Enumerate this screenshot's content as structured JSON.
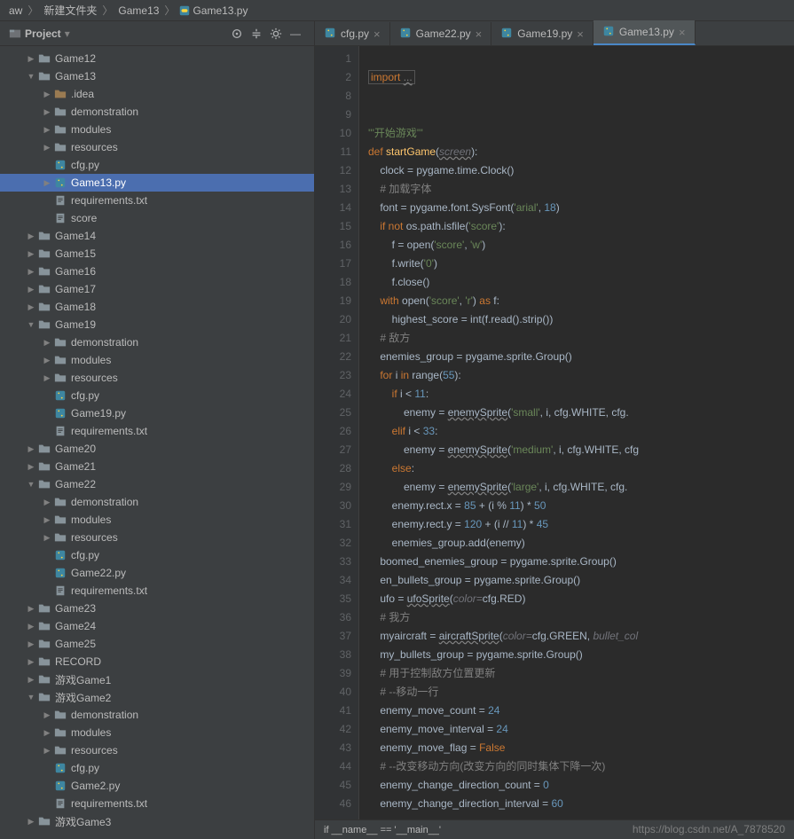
{
  "breadcrumb": [
    "aw",
    "新建文件夹",
    "Game13",
    "Game13.py"
  ],
  "sidebar": {
    "title": "Project",
    "toolbar_icons": [
      "target-icon",
      "collapse-icon",
      "gear-icon",
      "minimize-icon"
    ]
  },
  "tree": [
    {
      "label": "Game12",
      "depth": 1,
      "icon": "folder",
      "arrow": "closed"
    },
    {
      "label": "Game13",
      "depth": 1,
      "icon": "folder",
      "arrow": "open"
    },
    {
      "label": ".idea",
      "depth": 2,
      "icon": "folder-spec",
      "arrow": "closed"
    },
    {
      "label": "demonstration",
      "depth": 2,
      "icon": "folder",
      "arrow": "closed"
    },
    {
      "label": "modules",
      "depth": 2,
      "icon": "folder",
      "arrow": "closed"
    },
    {
      "label": "resources",
      "depth": 2,
      "icon": "folder",
      "arrow": "closed"
    },
    {
      "label": "cfg.py",
      "depth": 2,
      "icon": "py",
      "arrow": "none"
    },
    {
      "label": "Game13.py",
      "depth": 2,
      "icon": "py",
      "arrow": "closed",
      "selected": true
    },
    {
      "label": "requirements.txt",
      "depth": 2,
      "icon": "txt",
      "arrow": "none"
    },
    {
      "label": "score",
      "depth": 2,
      "icon": "txt",
      "arrow": "none"
    },
    {
      "label": "Game14",
      "depth": 1,
      "icon": "folder",
      "arrow": "closed"
    },
    {
      "label": "Game15",
      "depth": 1,
      "icon": "folder",
      "arrow": "closed"
    },
    {
      "label": "Game16",
      "depth": 1,
      "icon": "folder",
      "arrow": "closed"
    },
    {
      "label": "Game17",
      "depth": 1,
      "icon": "folder",
      "arrow": "closed"
    },
    {
      "label": "Game18",
      "depth": 1,
      "icon": "folder",
      "arrow": "closed"
    },
    {
      "label": "Game19",
      "depth": 1,
      "icon": "folder",
      "arrow": "open"
    },
    {
      "label": "demonstration",
      "depth": 2,
      "icon": "folder",
      "arrow": "closed"
    },
    {
      "label": "modules",
      "depth": 2,
      "icon": "folder",
      "arrow": "closed"
    },
    {
      "label": "resources",
      "depth": 2,
      "icon": "folder",
      "arrow": "closed"
    },
    {
      "label": "cfg.py",
      "depth": 2,
      "icon": "py",
      "arrow": "none"
    },
    {
      "label": "Game19.py",
      "depth": 2,
      "icon": "py",
      "arrow": "none"
    },
    {
      "label": "requirements.txt",
      "depth": 2,
      "icon": "txt",
      "arrow": "none"
    },
    {
      "label": "Game20",
      "depth": 1,
      "icon": "folder",
      "arrow": "closed"
    },
    {
      "label": "Game21",
      "depth": 1,
      "icon": "folder",
      "arrow": "closed"
    },
    {
      "label": "Game22",
      "depth": 1,
      "icon": "folder",
      "arrow": "open"
    },
    {
      "label": "demonstration",
      "depth": 2,
      "icon": "folder",
      "arrow": "closed"
    },
    {
      "label": "modules",
      "depth": 2,
      "icon": "folder",
      "arrow": "closed"
    },
    {
      "label": "resources",
      "depth": 2,
      "icon": "folder",
      "arrow": "closed"
    },
    {
      "label": "cfg.py",
      "depth": 2,
      "icon": "py",
      "arrow": "none"
    },
    {
      "label": "Game22.py",
      "depth": 2,
      "icon": "py",
      "arrow": "none"
    },
    {
      "label": "requirements.txt",
      "depth": 2,
      "icon": "txt",
      "arrow": "none"
    },
    {
      "label": "Game23",
      "depth": 1,
      "icon": "folder",
      "arrow": "closed"
    },
    {
      "label": "Game24",
      "depth": 1,
      "icon": "folder",
      "arrow": "closed"
    },
    {
      "label": "Game25",
      "depth": 1,
      "icon": "folder",
      "arrow": "closed"
    },
    {
      "label": "RECORD",
      "depth": 1,
      "icon": "folder",
      "arrow": "closed"
    },
    {
      "label": "游戏Game1",
      "depth": 1,
      "icon": "folder",
      "arrow": "closed"
    },
    {
      "label": "游戏Game2",
      "depth": 1,
      "icon": "folder",
      "arrow": "open"
    },
    {
      "label": "demonstration",
      "depth": 2,
      "icon": "folder",
      "arrow": "closed"
    },
    {
      "label": "modules",
      "depth": 2,
      "icon": "folder",
      "arrow": "closed"
    },
    {
      "label": "resources",
      "depth": 2,
      "icon": "folder",
      "arrow": "closed"
    },
    {
      "label": "cfg.py",
      "depth": 2,
      "icon": "py",
      "arrow": "none"
    },
    {
      "label": "Game2.py",
      "depth": 2,
      "icon": "py",
      "arrow": "none"
    },
    {
      "label": "requirements.txt",
      "depth": 2,
      "icon": "txt",
      "arrow": "none"
    },
    {
      "label": "游戏Game3",
      "depth": 1,
      "icon": "folder",
      "arrow": "closed"
    }
  ],
  "tabs": [
    {
      "label": "cfg.py",
      "active": false
    },
    {
      "label": "Game22.py",
      "active": false
    },
    {
      "label": "Game19.py",
      "active": false
    },
    {
      "label": "Game13.py",
      "active": true
    }
  ],
  "gutter_lines": [
    "1",
    "2",
    "8",
    "9",
    "10",
    "11",
    "12",
    "13",
    "14",
    "15",
    "16",
    "17",
    "18",
    "19",
    "20",
    "21",
    "22",
    "23",
    "24",
    "25",
    "26",
    "27",
    "28",
    "29",
    "30",
    "31",
    "32",
    "33",
    "34",
    "35",
    "36",
    "37",
    "38",
    "39",
    "40",
    "41",
    "42",
    "43",
    "44",
    "45",
    "46"
  ],
  "code_lines": [
    {
      "html": ""
    },
    {
      "html": "<span class='boxed'><span class='kw'>import</span> <span class='gray warn'>...</span></span>"
    },
    {
      "html": ""
    },
    {
      "html": ""
    },
    {
      "html": "<span class='str'>'''开始游戏'''</span>"
    },
    {
      "html": "<span class='kw'>def </span><span class='fn'>startGame</span>(<span class='param warn'>screen</span>):"
    },
    {
      "html": "    clock = pygame.time.Clock()"
    },
    {
      "html": "    <span class='cm'># 加载字体</span>"
    },
    {
      "html": "    font = pygame.font.SysFont(<span class='str'>'arial'</span>, <span class='num'>18</span>)"
    },
    {
      "html": "    <span class='kw'>if not </span>os.path.isfile(<span class='str'>'score'</span>):"
    },
    {
      "html": "        f = open(<span class='str'>'score'</span>, <span class='str'>'w'</span>)"
    },
    {
      "html": "        f.write(<span class='str'>'0'</span>)"
    },
    {
      "html": "        f.close()"
    },
    {
      "html": "    <span class='kw'>with </span>open(<span class='str'>'score'</span>, <span class='str'>'r'</span>) <span class='kw'>as</span> f:"
    },
    {
      "html": "        highest_score = int(f.read().strip())"
    },
    {
      "html": "    <span class='cm'># 敌方</span>"
    },
    {
      "html": "    enemies_group = pygame.sprite.Group()"
    },
    {
      "html": "    <span class='kw'>for </span>i <span class='kw'>in </span>range(<span class='num'>55</span>):"
    },
    {
      "html": "        <span class='kw'>if </span>i &lt; <span class='num'>11</span>:"
    },
    {
      "html": "            enemy = <span class='warn'>enemySprite</span>(<span class='str'>'small'</span>, i, cfg.WHITE, cfg."
    },
    {
      "html": "        <span class='kw'>elif </span>i &lt; <span class='num'>33</span>:"
    },
    {
      "html": "            enemy = <span class='warn'>enemySprite</span>(<span class='str'>'medium'</span>, i, cfg.WHITE, cfg"
    },
    {
      "html": "        <span class='kw'>else</span>:"
    },
    {
      "html": "            enemy = <span class='warn'>enemySprite</span>(<span class='str'>'large'</span>, i, cfg.WHITE, cfg."
    },
    {
      "html": "        enemy.rect.x = <span class='num'>85</span> + (i % <span class='num'>11</span>) * <span class='num'>50</span>"
    },
    {
      "html": "        enemy.rect.y = <span class='num'>120</span> + (i // <span class='num'>11</span>) * <span class='num'>45</span>"
    },
    {
      "html": "        enemies_group.add(enemy)"
    },
    {
      "html": "    boomed_enemies_group = pygame.sprite.Group()"
    },
    {
      "html": "    en_bullets_group = pygame.sprite.Group()"
    },
    {
      "html": "    ufo = <span class='warn'>ufoSprite</span>(<span class='param'>color=</span>cfg.RED)"
    },
    {
      "html": "    <span class='cm'># 我方</span>"
    },
    {
      "html": "    myaircraft = <span class='warn'>aircraftSprite</span>(<span class='param'>color=</span>cfg.GREEN, <span class='param'>bullet_col</span>"
    },
    {
      "html": "    my_bullets_group = pygame.sprite.Group()"
    },
    {
      "html": "    <span class='cm'># 用于控制敌方位置更新</span>"
    },
    {
      "html": "    <span class='cm'># --移动一行</span>"
    },
    {
      "html": "    enemy_move_count = <span class='num'>24</span>"
    },
    {
      "html": "    enemy_move_interval = <span class='num'>24</span>"
    },
    {
      "html": "    enemy_move_flag = <span class='kw'>False</span>"
    },
    {
      "html": "    <span class='cm'># --改变移动方向(改变方向的同时集体下降一次)</span>"
    },
    {
      "html": "    enemy_change_direction_count = <span class='num'>0</span>"
    },
    {
      "html": "    enemy_change_direction_interval = <span class='num'>60</span>"
    }
  ],
  "bottom_crumb": "if __name__ == '__main__'",
  "watermark": "https://blog.csdn.net/A_7878520"
}
